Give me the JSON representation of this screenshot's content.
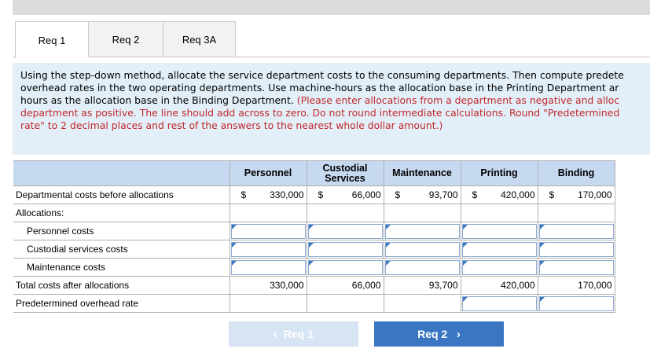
{
  "tabs": [
    {
      "label": "Req 1",
      "active": true
    },
    {
      "label": "Req 2",
      "active": false
    },
    {
      "label": "Req 3A",
      "active": false
    }
  ],
  "instructions": {
    "line1": "Using the step-down method, allocate the service department costs to the consuming departments. Then compute predete",
    "line2": "overhead rates in the two operating departments. Use machine-hours as the allocation base in the Printing Department ar",
    "line3_black": "hours as the allocation base in the Binding Department. ",
    "line3_red": "(Please enter allocations from a department as negative and alloc",
    "line4": "department as positive. The line should add across to zero. Do not round intermediate calculations. Round \"Predetermined",
    "line5": "rate\" to 2 decimal places and rest of the answers to the nearest whole dollar amount.)"
  },
  "table": {
    "headers": [
      "Personnel",
      "Custodial Services",
      "Maintenance",
      "Printing",
      "Binding"
    ],
    "rows": {
      "dept_costs": {
        "label": "Departmental costs before allocations",
        "currency": "$",
        "values": [
          "330,000",
          "66,000",
          "93,700",
          "420,000",
          "170,000"
        ]
      },
      "allocations": {
        "label": "Allocations:"
      },
      "personnel": {
        "label": "Personnel costs"
      },
      "custodial": {
        "label": "Custodial services costs"
      },
      "maintenance": {
        "label": "Maintenance costs"
      },
      "total": {
        "label": "Total costs after allocations",
        "values": [
          "330,000",
          "66,000",
          "93,700",
          "420,000",
          "170,000"
        ]
      },
      "rate": {
        "label": "Predetermined overhead rate"
      }
    }
  },
  "nav": {
    "prev_label": "Req 1",
    "next_label": "Req 2",
    "prev_icon": "chevron-left-icon",
    "next_icon": "chevron-right-icon"
  }
}
